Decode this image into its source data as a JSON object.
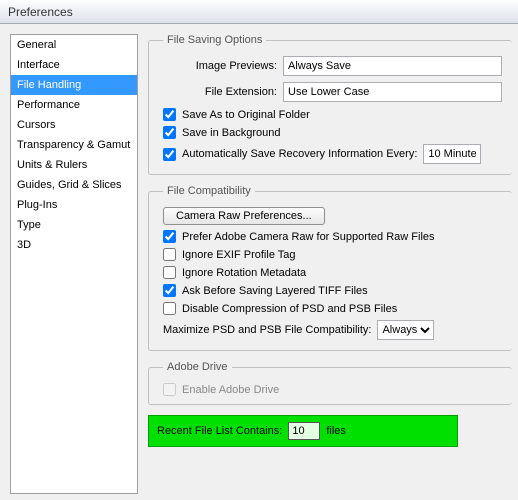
{
  "window": {
    "title": "Preferences"
  },
  "sidebar": {
    "items": [
      "General",
      "Interface",
      "File Handling",
      "Performance",
      "Cursors",
      "Transparency & Gamut",
      "Units & Rulers",
      "Guides, Grid & Slices",
      "Plug-Ins",
      "Type",
      "3D"
    ],
    "selected_index": 2
  },
  "groups": {
    "saving": {
      "legend": "File Saving Options"
    },
    "compat": {
      "legend": "File Compatibility"
    },
    "adrive": {
      "legend": "Adobe Drive"
    }
  },
  "saving": {
    "image_previews_label": "Image Previews:",
    "image_previews_value": "Always Save",
    "file_extension_label": "File Extension:",
    "file_extension_value": "Use Lower Case",
    "save_original": {
      "label": "Save As to Original Folder",
      "checked": true
    },
    "save_background": {
      "label": "Save in Background",
      "checked": true
    },
    "autosave": {
      "label": "Automatically Save Recovery Information Every:",
      "checked": true,
      "interval": "10 Minute"
    }
  },
  "compat": {
    "camera_raw_btn": "Camera Raw Preferences...",
    "prefer_acr": {
      "label": "Prefer Adobe Camera Raw for Supported Raw Files",
      "checked": true
    },
    "ignore_exif": {
      "label": "Ignore EXIF Profile Tag",
      "checked": false
    },
    "ignore_rotation": {
      "label": "Ignore Rotation Metadata",
      "checked": false
    },
    "ask_tiff": {
      "label": "Ask Before Saving Layered TIFF Files",
      "checked": true
    },
    "disable_psd_comp": {
      "label": "Disable Compression of PSD and PSB Files",
      "checked": false
    },
    "maximize_label": "Maximize PSD and PSB File Compatibility:",
    "maximize_value": "Always"
  },
  "adobe_drive": {
    "enable": {
      "label": "Enable Adobe Drive",
      "checked": false,
      "disabled": true
    }
  },
  "recent": {
    "prefix": "Recent File List Contains:",
    "value": "10",
    "suffix": "files"
  }
}
